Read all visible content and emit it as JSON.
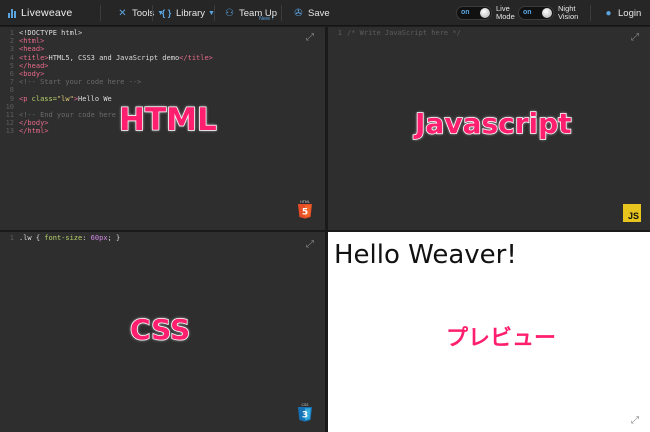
{
  "app": {
    "name": "Liveweave"
  },
  "toolbar": {
    "tools": "Tools",
    "library": "Library",
    "team_up": "Team Up",
    "team_up_badge": "New !",
    "save": "Save",
    "live_mode": {
      "state": "on",
      "label_top": "Live",
      "label_bottom": "Mode"
    },
    "night_vision": {
      "state": "on",
      "label_top": "Night",
      "label_bottom": "Vision"
    },
    "login": "Login"
  },
  "panes": {
    "html": {
      "label": "HTML",
      "badge_text": "HTML",
      "badge_num": "5",
      "lines": [
        [
          {
            "t": "plain",
            "s": "<!DOCTYPE html>"
          }
        ],
        [
          {
            "t": "tag",
            "s": "<html>"
          }
        ],
        [
          {
            "t": "tag",
            "s": "<head>"
          }
        ],
        [
          {
            "t": "tag",
            "s": "<title>"
          },
          {
            "t": "plain",
            "s": "HTML5, CSS3 and JavaScript demo"
          },
          {
            "t": "tag",
            "s": "</title>"
          }
        ],
        [
          {
            "t": "tag",
            "s": "</head>"
          }
        ],
        [
          {
            "t": "tag",
            "s": "<body>"
          }
        ],
        [
          {
            "t": "com",
            "s": "<!-- Start your code here -->"
          }
        ],
        [],
        [
          {
            "t": "tag",
            "s": "<p "
          },
          {
            "t": "attr",
            "s": "class="
          },
          {
            "t": "str",
            "s": "\"lw\""
          },
          {
            "t": "tag",
            "s": ">"
          },
          {
            "t": "plain",
            "s": "Hello We"
          }
        ],
        [],
        [
          {
            "t": "com",
            "s": "<!-- End your code here -->"
          }
        ],
        [
          {
            "t": "tag",
            "s": "</body>"
          }
        ],
        [
          {
            "t": "tag",
            "s": "</html>"
          }
        ]
      ]
    },
    "js": {
      "label": "Javascript",
      "badge_text": "JS",
      "lines": [
        [
          {
            "t": "js",
            "s": "/* Write JavaScript here */"
          }
        ]
      ]
    },
    "css": {
      "label": "CSS",
      "badge_text": "CSS",
      "badge_num": "3",
      "lines": [
        [
          {
            "t": "plain",
            "s": ".lw { "
          },
          {
            "t": "attr",
            "s": "font-size"
          },
          {
            "t": "plain",
            "s": ": "
          },
          {
            "t": "num",
            "s": "60px"
          },
          {
            "t": "plain",
            "s": "; }"
          }
        ]
      ]
    },
    "preview": {
      "label": "プレビュー",
      "content": "Hello Weaver!"
    }
  },
  "colors": {
    "accent": "#5aa4e0",
    "label_pink": "#ff1f6e",
    "html5_orange": "#e44d26",
    "css3_blue": "#1572b6",
    "js_yellow": "#e8c41f"
  }
}
